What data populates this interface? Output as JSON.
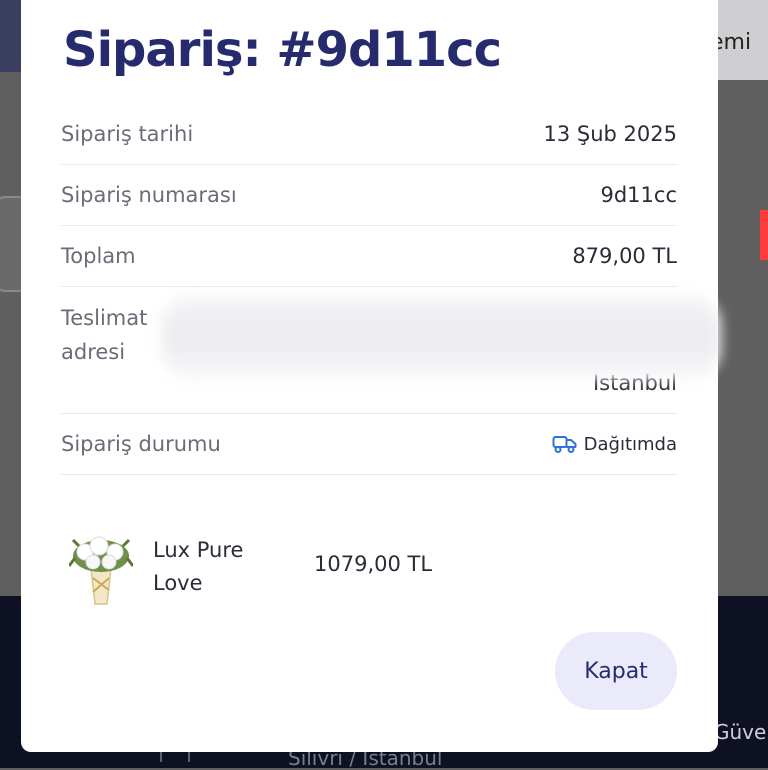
{
  "background": {
    "menu_text": "emi",
    "footer_text": "Silivri / Istanbul",
    "footer_right_text": "Güve"
  },
  "modal": {
    "title": "Sipariş: #9d11cc",
    "rows": [
      {
        "label": "Sipariş tarihi",
        "value": "13 Şub 2025"
      },
      {
        "label": "Sipariş numarası",
        "value": "9d11cc"
      },
      {
        "label": "Toplam",
        "value": "879,00 TL"
      },
      {
        "label": "Teslimat adresi",
        "value": "Istanbul"
      },
      {
        "label": "Sipariş durumu",
        "value": "Dağıtımda",
        "icon": "truck-icon"
      }
    ],
    "product": {
      "name": "Lux Pure Love",
      "price": "1079,00 TL",
      "image": "flower-bouquet-icon"
    },
    "close_label": "Kapat"
  },
  "colors": {
    "title": "#262b6e",
    "status_icon": "#2f73d8",
    "button_bg": "#eaeafb"
  }
}
